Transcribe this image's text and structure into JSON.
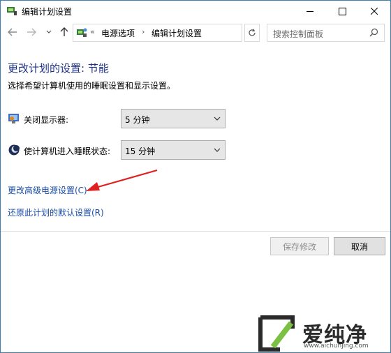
{
  "window": {
    "title": "编辑计划设置"
  },
  "navigation": {
    "breadcrumb_prefix": "«",
    "breadcrumb": [
      "电源选项",
      "编辑计划设置"
    ],
    "separator": "›",
    "search_placeholder": "搜索控制面板"
  },
  "main": {
    "title": "更改计划的设置: 节能",
    "subtitle": "选择希望计算机使用的睡眠设置和显示设置。",
    "settings": [
      {
        "label": "关闭显示器:",
        "value": "5 分钟",
        "icon": "monitor-icon"
      },
      {
        "label": "使计算机进入睡眠状态:",
        "value": "15 分钟",
        "icon": "sleep-moon-icon"
      }
    ],
    "links": {
      "advanced": "更改高级电源设置(C)",
      "restore": "还原此计划的默认设置(R)"
    }
  },
  "footer": {
    "save_label": "保存修改",
    "cancel_label": "取消"
  },
  "watermark": {
    "text": "爱纯净",
    "url": "www.aichunjing.com"
  },
  "colors": {
    "title_blue": "#1e3287",
    "link_blue": "#1a4ea8",
    "annotation_red": "#e02020",
    "window_border": "#3c7fb1",
    "watermark_green": "#7ac143"
  }
}
